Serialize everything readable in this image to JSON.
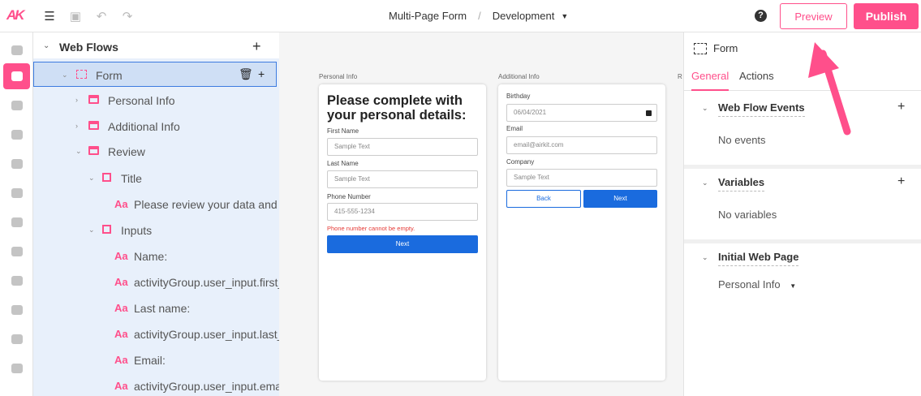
{
  "topbar": {
    "logo": "AK",
    "project": "Multi-Page Form",
    "separator": "/",
    "environment": "Development",
    "help": "?",
    "preview_label": "Preview",
    "publish_label": "Publish"
  },
  "rail": {
    "items": [
      "connect",
      "web-flows",
      "chat",
      "chat-2",
      "voice",
      "data-flows",
      "messaging",
      "components",
      "media",
      "themes",
      "calendar",
      "contacts"
    ],
    "active": "web-flows"
  },
  "tree": {
    "title": "Web Flows",
    "rows": [
      {
        "label": "Form"
      },
      {
        "label": "Personal Info"
      },
      {
        "label": "Additional Info"
      },
      {
        "label": "Review"
      },
      {
        "label": "Title"
      },
      {
        "label": "Please review your data and"
      },
      {
        "label": "Inputs"
      },
      {
        "label": "Name:"
      },
      {
        "label": "activityGroup.user_input.first_"
      },
      {
        "label": "Last name:"
      },
      {
        "label": "activityGroup.user_input.last_"
      },
      {
        "label": "Email:"
      },
      {
        "label": "activityGroup.user_input.ema"
      }
    ]
  },
  "canvas": {
    "page1": {
      "label": "Personal Info",
      "heading": "Please complete with your personal details:",
      "first_name_label": "First Name",
      "first_name_placeholder": "Sample Text",
      "last_name_label": "Last Name",
      "last_name_placeholder": "Sample Text",
      "phone_label": "Phone Number",
      "phone_placeholder": "415-555-1234",
      "error": "Phone number cannot be empty.",
      "next": "Next"
    },
    "page2": {
      "label": "Additional Info",
      "birthday_label": "Birthday",
      "birthday_value": "06/04/2021",
      "email_label": "Email",
      "email_placeholder": "email@airkit.com",
      "company_label": "Company",
      "company_placeholder": "Sample Text",
      "back": "Back",
      "next": "Next"
    },
    "page3_label": "R"
  },
  "props": {
    "title": "Form",
    "tabs": [
      "General",
      "Actions"
    ],
    "events_title": "Web Flow Events",
    "events_empty": "No events",
    "variables_title": "Variables",
    "variables_empty": "No variables",
    "initial_title": "Initial Web Page",
    "initial_value": "Personal Info"
  },
  "colors": {
    "accent": "#ff4f8b",
    "primary_button": "#1a6bde",
    "error": "#e53935",
    "tree_bg": "#e8f0fb"
  }
}
